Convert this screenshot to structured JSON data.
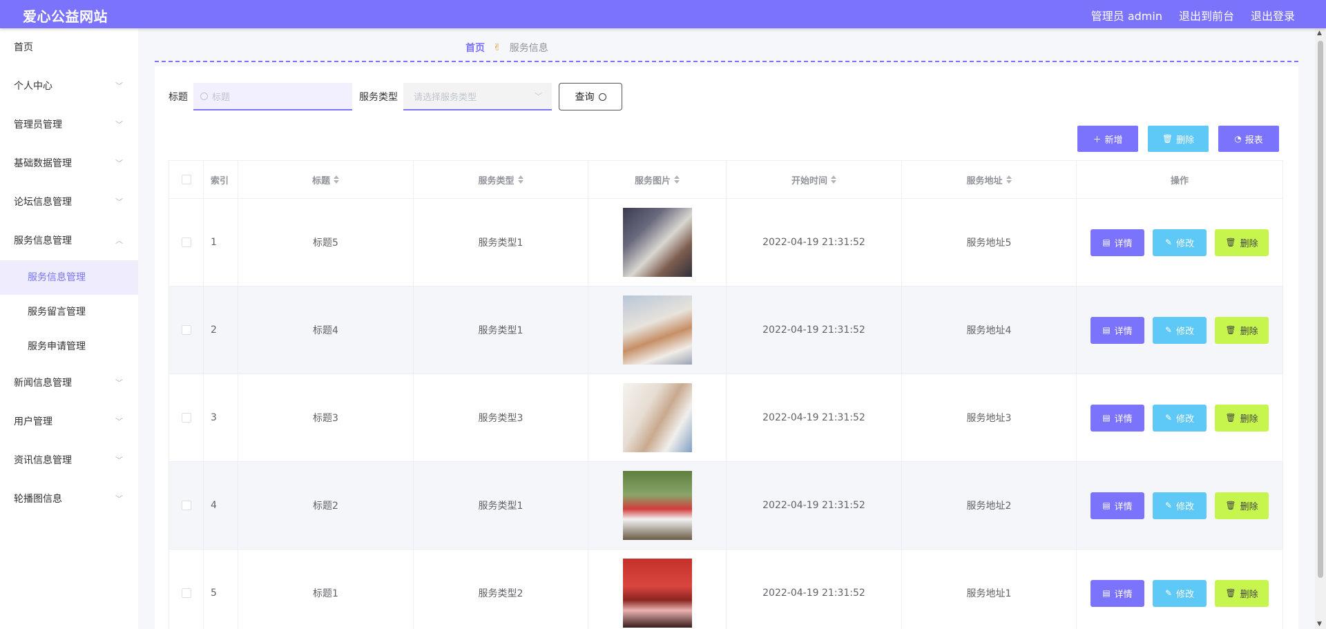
{
  "header": {
    "site_title": "爱心公益网站",
    "admin_label": "管理员 admin",
    "back_label": "退出到前台",
    "logout_label": "退出登录"
  },
  "sidebar": {
    "items": [
      {
        "label": "首页"
      },
      {
        "label": "个人中心"
      },
      {
        "label": "管理员管理"
      },
      {
        "label": "基础数据管理"
      },
      {
        "label": "论坛信息管理"
      },
      {
        "label": "服务信息管理"
      },
      {
        "label": "新闻信息管理"
      },
      {
        "label": "用户管理"
      },
      {
        "label": "资讯信息管理"
      },
      {
        "label": "轮播图信息"
      }
    ],
    "subitems": [
      {
        "label": "服务信息管理"
      },
      {
        "label": "服务留言管理"
      },
      {
        "label": "服务申请管理"
      }
    ]
  },
  "breadcrumb": {
    "home": "首页",
    "separator": "✌",
    "current": "服务信息"
  },
  "search": {
    "title_label": "标题",
    "title_placeholder": "标题",
    "type_label": "服务类型",
    "type_placeholder": "请选择服务类型",
    "query_label": "查询"
  },
  "actions": {
    "add_label": "新增",
    "delete_label": "删除",
    "report_label": "报表"
  },
  "table": {
    "headers": {
      "index": "索引",
      "title": "标题",
      "type": "服务类型",
      "image": "服务图片",
      "start_time": "开始时间",
      "address": "服务地址",
      "operation": "操作"
    },
    "rows": [
      {
        "index": "1",
        "title": "标题5",
        "type": "服务类型1",
        "start_time": "2022-04-19 21:31:52",
        "address": "服务地址5"
      },
      {
        "index": "2",
        "title": "标题4",
        "type": "服务类型1",
        "start_time": "2022-04-19 21:31:52",
        "address": "服务地址4"
      },
      {
        "index": "3",
        "title": "标题3",
        "type": "服务类型3",
        "start_time": "2022-04-19 21:31:52",
        "address": "服务地址3"
      },
      {
        "index": "4",
        "title": "标题2",
        "type": "服务类型1",
        "start_time": "2022-04-19 21:31:52",
        "address": "服务地址2"
      },
      {
        "index": "5",
        "title": "标题1",
        "type": "服务类型2",
        "start_time": "2022-04-19 21:31:52",
        "address": "服务地址1"
      }
    ],
    "row_actions": {
      "detail": "详情",
      "edit": "修改",
      "delete": "删除"
    }
  },
  "colors": {
    "primary": "#7b73fb",
    "info": "#5ec8f7",
    "lime": "#c6f54e"
  }
}
